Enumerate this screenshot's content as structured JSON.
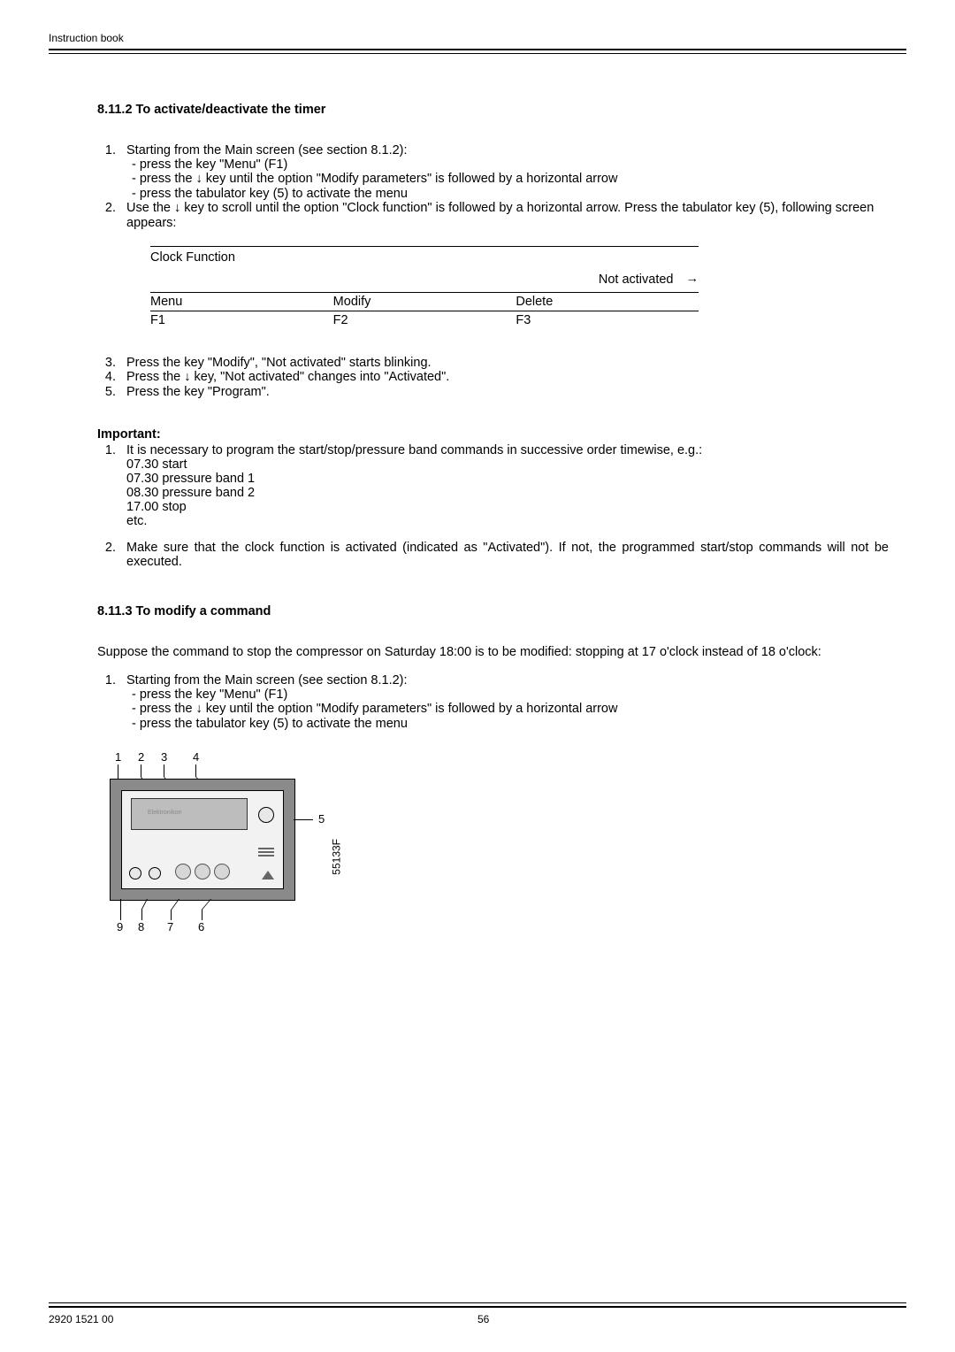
{
  "header": {
    "title": "Instruction book"
  },
  "footer": {
    "docnum": "2920 1521 00",
    "pagenum": "56"
  },
  "section_8_11_2": {
    "title": "8.11.2 To activate/deactivate the timer",
    "step1": "Starting from the Main screen (see section 8.1.2):",
    "step1a": "press the key \"Menu\" (F1)",
    "step1b_pre": "press the ",
    "step1b_post": " key until the option \"Modify parameters\" is followed by a horizontal arrow",
    "step1c": "press the tabulator key (5) to activate the menu",
    "step2_pre": "Use the ",
    "step2_post": " key to scroll until the option \"Clock function\" is followed by a horizontal arrow.  Press the tabulator key (5), following screen appears:",
    "step3": "Press the key \"Modify\", \"Not activated\" starts blinking.",
    "step4_pre": "Press the ",
    "step4_post": " key, \"Not activated\" changes into \"Activated\".",
    "step5": "Press the key \"Program\"."
  },
  "screen": {
    "title": "Clock Function",
    "status": "Not activated",
    "arrow": "→",
    "r1c1": "Menu",
    "r1c2": "Modify",
    "r1c3": "Delete",
    "r2c1": "F1",
    "r2c2": "F2",
    "r2c3": "F3"
  },
  "important": {
    "label": "Important:",
    "p1a": "It is necessary to program the start/stop/pressure band commands in successive order timewise, e.g.:",
    "ex1": "07.30 start",
    "ex2": "07.30 pressure band 1",
    "ex3": "08.30 pressure band 2",
    "ex4": "17.00 stop",
    "ex5": "etc.",
    "p2": "Make sure that the clock function is activated (indicated as \"Activated\"). If not, the programmed start/stop commands will not be executed."
  },
  "section_8_11_3": {
    "title": "8.11.3 To modify a command",
    "intro": "Suppose the command to stop the compressor on Saturday 18:00 is to be modified: stopping at 17 o'clock instead of 18 o'clock:",
    "step1": "Starting from the Main screen (see section 8.1.2):",
    "step1a": "press the key \"Menu\" (F1)",
    "step1b_pre": "press the ",
    "step1b_post": " key until the option \"Modify parameters\" is followed by a horizontal arrow",
    "step1c": "press the tabulator key (5) to activate the menu"
  },
  "diagram": {
    "top": {
      "n1": "1",
      "n2": "2",
      "n3": "3",
      "n4": "4"
    },
    "right": {
      "n5": "5"
    },
    "bottom": {
      "n6": "6",
      "n7": "7",
      "n8": "8",
      "n9": "9"
    },
    "figno": "55133F",
    "brand": "Elektronikon"
  },
  "glyphs": {
    "down_arrow": "↓"
  }
}
